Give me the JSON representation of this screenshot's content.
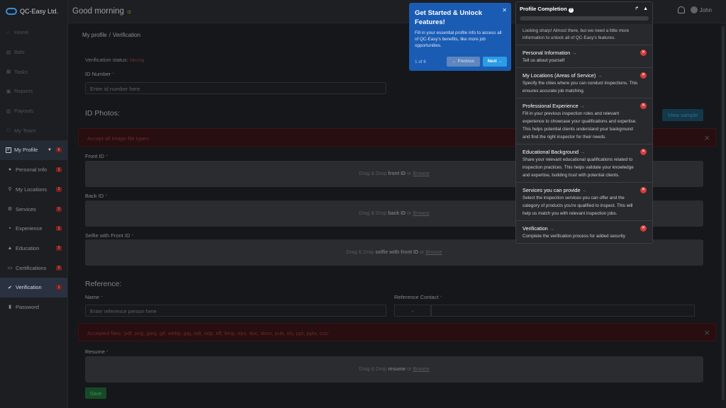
{
  "brand": {
    "name": "QC-Easy Ltd."
  },
  "topbar": {
    "greeting": "Good morning",
    "user": "John"
  },
  "sidebar": {
    "items": [
      {
        "label": "Home",
        "icon": "home-icon",
        "glyph": "⌂"
      },
      {
        "label": "Bids",
        "icon": "bids-icon",
        "glyph": "▤"
      },
      {
        "label": "Tasks",
        "icon": "tasks-icon",
        "glyph": "▦"
      },
      {
        "label": "Reports",
        "icon": "reports-icon",
        "glyph": "▣"
      },
      {
        "label": "Payouts",
        "icon": "payouts-icon",
        "glyph": "▥"
      },
      {
        "label": "My Team",
        "icon": "team-icon",
        "glyph": "⚇"
      }
    ],
    "profile": {
      "label": "My Profile",
      "badge": "6"
    },
    "sub": [
      {
        "label": "Personal Info",
        "icon": "person-icon",
        "glyph": "●",
        "badge": "1"
      },
      {
        "label": "My Locations",
        "icon": "location-icon",
        "glyph": "⚲",
        "badge": "1"
      },
      {
        "label": "Services",
        "icon": "services-icon",
        "glyph": "⚙",
        "badge": "1"
      },
      {
        "label": "Experience",
        "icon": "briefcase-icon",
        "glyph": "▪",
        "badge": "1"
      },
      {
        "label": "Education",
        "icon": "graduation-icon",
        "glyph": "▲",
        "badge": "1"
      },
      {
        "label": "Certifications",
        "icon": "certificate-icon",
        "glyph": "▭",
        "badge": "1"
      },
      {
        "label": "Verification",
        "icon": "check-circle-icon",
        "glyph": "✔",
        "badge": "1"
      },
      {
        "label": "Password",
        "icon": "lock-icon",
        "glyph": "▮"
      }
    ]
  },
  "main": {
    "breadcrumb": {
      "root": "My profile",
      "separator": "/",
      "current": "Verification"
    },
    "status_label": "Verification status:",
    "status_value": "Missing",
    "id_number": {
      "label": "ID Number",
      "required": "*",
      "placeholder": "Enter id number here"
    },
    "id_photos": {
      "title": "ID Photos:",
      "view_sample": "View sample",
      "alert": "Accept all image file types",
      "close": "×"
    },
    "front_id": {
      "label": "Front ID",
      "required": "*",
      "pre": "Drag & Drop",
      "bold": "front ID",
      "or": "or",
      "browse": "Browse"
    },
    "back_id": {
      "label": "Back ID",
      "required": "*",
      "pre": "Drag & Drop",
      "bold": "back ID",
      "or": "or",
      "browse": "Browse"
    },
    "selfie": {
      "label": "Selfie with Front ID",
      "required": "*",
      "pre": "Drag & Drop",
      "bold": "selfie with front ID",
      "or": "or",
      "browse": "Browse"
    },
    "reference": {
      "title": "Reference:",
      "name_label": "Name",
      "name_req": "*",
      "name_placeholder": "Enter reference person here",
      "contact_label": "Reference Contact",
      "contact_req": "*",
      "code_chev": "⌄"
    },
    "accepted": {
      "text": "Accepted files: 'pdf, png, jpeg, gif, webp, jpg, odt, odp, tiff, bmp, eps, doc, docx, pub, xls, ppt, pptx, csv,'",
      "close": "×"
    },
    "resume": {
      "label": "Resume",
      "required": "*",
      "pre": "Drag & Drop",
      "bold": "resume",
      "or": "or",
      "browse": "Browse"
    },
    "save": "Save"
  },
  "tour": {
    "title": "Get Started & Unlock Features!",
    "body": "Fill in your essential profile info to access all of QC-Easy's benefits, like more job opportunities.",
    "steps": "1 of 6",
    "previous": "← Previous",
    "next": "Next →",
    "close": "✕"
  },
  "profile_completion": {
    "title": "Profile Completion",
    "help": "?",
    "intro": "Looking sharp! Almost there, but we need a little more information to unlock all of QC-Easy's features.",
    "items": [
      {
        "title": "Personal Information",
        "desc": "Tell us about yourself"
      },
      {
        "title": "My Locations (Areas of Service)",
        "desc": "Specify the cities where you can conduct inspections. This ensures accurate job matching."
      },
      {
        "title": "Professional Experience",
        "desc": "Fill in your previous inspection roles and relevant experience to showcase your qualifications and expertise. This helps potential clients understand your background and find the right inspector for their needs."
      },
      {
        "title": "Educational Background",
        "desc": "Share your relevant educational qualifications related to inspection practices. This helps validate your knowledge and expertise, building trust with potential clients."
      },
      {
        "title": "Services you can provide",
        "desc": "Select the inspection services you can offer and the category of products you're qualified to inspect. This will help us match you with relevant inspection jobs."
      },
      {
        "title": "Verification",
        "desc": "Complete the verification process for added security"
      }
    ],
    "arrow": "→",
    "status_icon": "✕",
    "open_icon": "↱",
    "collapse_icon": "▲"
  },
  "colors": {
    "accent": "#3a8ed8",
    "tour_bg": "#1a5cb3",
    "error": "#d43b3b",
    "save": "#164a26"
  }
}
